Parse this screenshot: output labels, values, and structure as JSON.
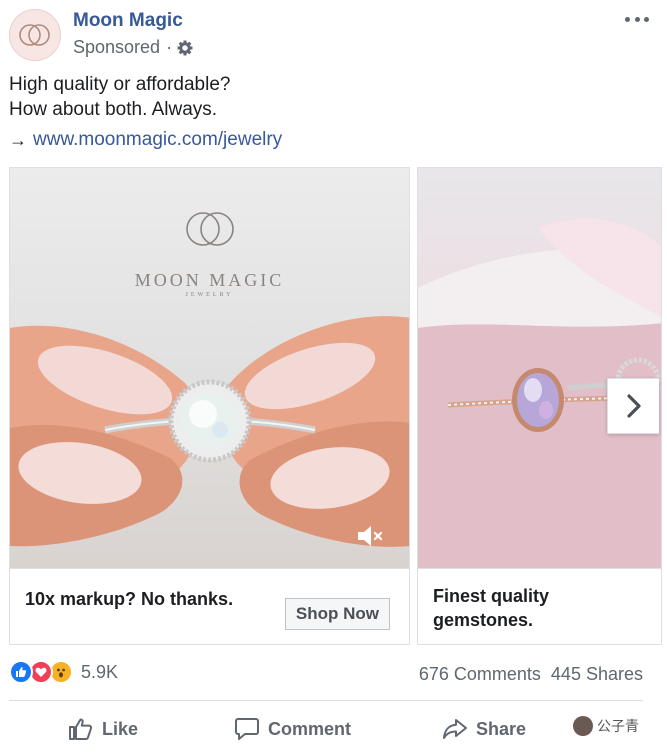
{
  "header": {
    "page_name": "Moon Magic",
    "sponsored": "Sponsored",
    "dot": "·"
  },
  "post": {
    "line1": "High quality or affordable?",
    "line2": "How about both. Always.",
    "link_arrow": "→",
    "link_url": "www.moonmagic.com/jewelry"
  },
  "carousel": {
    "cards": [
      {
        "brand_name": "MOON MAGIC",
        "brand_sub": "JEWELRY",
        "headline": "10x markup? No thanks.",
        "cta": "Shop Now"
      },
      {
        "headline": "Finest quality gemstones."
      }
    ]
  },
  "engagement": {
    "reaction_count": "5.9K",
    "comments": "676 Comments",
    "shares": "445 Shares"
  },
  "actions": {
    "like": "Like",
    "comment": "Comment",
    "share": "Share"
  },
  "watermark": {
    "text": "公子青"
  },
  "colors": {
    "link": "#385898",
    "like": "#1877f2",
    "love": "#f33e58",
    "wow": "#f7b125"
  }
}
